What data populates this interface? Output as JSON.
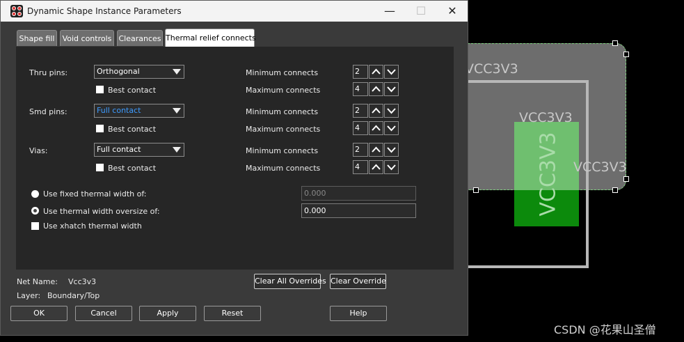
{
  "window": {
    "title": "Dynamic Shape Instance Parameters",
    "minimize_glyph": "—",
    "maximize_glyph": "☐",
    "close_glyph": "✕"
  },
  "tabs": [
    {
      "label": "Shape fill",
      "active": false
    },
    {
      "label": "Void controls",
      "active": false
    },
    {
      "label": "Clearances",
      "active": false
    },
    {
      "label": "Thermal relief connects",
      "active": true
    }
  ],
  "thru_pins": {
    "label": "Thru pins:",
    "mode": "Orthogonal",
    "best_contact": "Best contact",
    "min_label": "Minimum connects",
    "min_value": "2",
    "max_label": "Maximum connects",
    "max_value": "4"
  },
  "smd_pins": {
    "label": "Smd pins:",
    "mode": "Full contact",
    "best_contact": "Best contact",
    "min_label": "Minimum connects",
    "min_value": "2",
    "max_label": "Maximum connects",
    "max_value": "4"
  },
  "vias": {
    "label": "Vias:",
    "mode": "Full contact",
    "best_contact": "Best contact",
    "min_label": "Minimum connects",
    "min_value": "2",
    "max_label": "Maximum connects",
    "max_value": "4"
  },
  "thermal_width": {
    "fixed_label": "Use fixed thermal width of:",
    "fixed_value": "0.000",
    "oversize_label": "Use thermal width oversize of:",
    "oversize_value": "0.000",
    "xhatch_label": "Use xhatch thermal width",
    "selected": "oversize"
  },
  "info": {
    "net_name_label": "Net Name:",
    "net_name_value": "Vcc3v3",
    "layer_label": "Layer:",
    "layer_value": "Boundary/Top"
  },
  "buttons": {
    "clear_all_overrides": "Clear All Overrides",
    "clear_override": "Clear Override",
    "ok": "OK",
    "cancel": "Cancel",
    "apply": "Apply",
    "reset": "Reset",
    "help": "Help"
  },
  "canvas": {
    "net_label_1": "VCC3V3",
    "net_label_2": "VCC3V3",
    "net_label_3": "VCC3V3",
    "net_label_vertical": "VCC3V3",
    "watermark": "CSDN @花果山圣僧"
  },
  "colors": {
    "dialog_bg": "#3a3a3a",
    "panel_bg": "#262626",
    "highlight_text": "#3d9bff",
    "shape_gray": "#6d6d6d",
    "shape_green": "#0c8a0c"
  }
}
